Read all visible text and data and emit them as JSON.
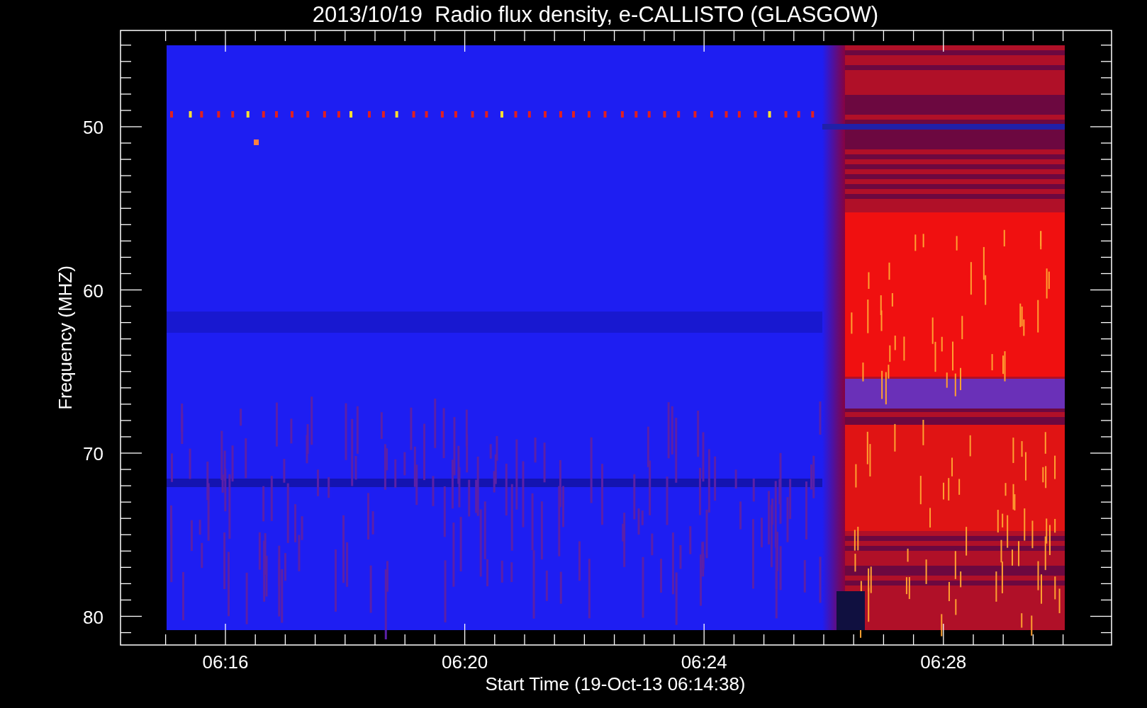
{
  "title": "2013/10/19  Radio flux density, e-CALLISTO (GLASGOW)",
  "y_axis": {
    "label": "Frequency (MHZ)",
    "ticks": [
      "50",
      "60",
      "70",
      "80"
    ]
  },
  "x_axis": {
    "label": "Start Time (19-Oct-13 06:14:38)",
    "ticks": [
      "06:16",
      "06:20",
      "06:24",
      "06:28"
    ]
  }
}
